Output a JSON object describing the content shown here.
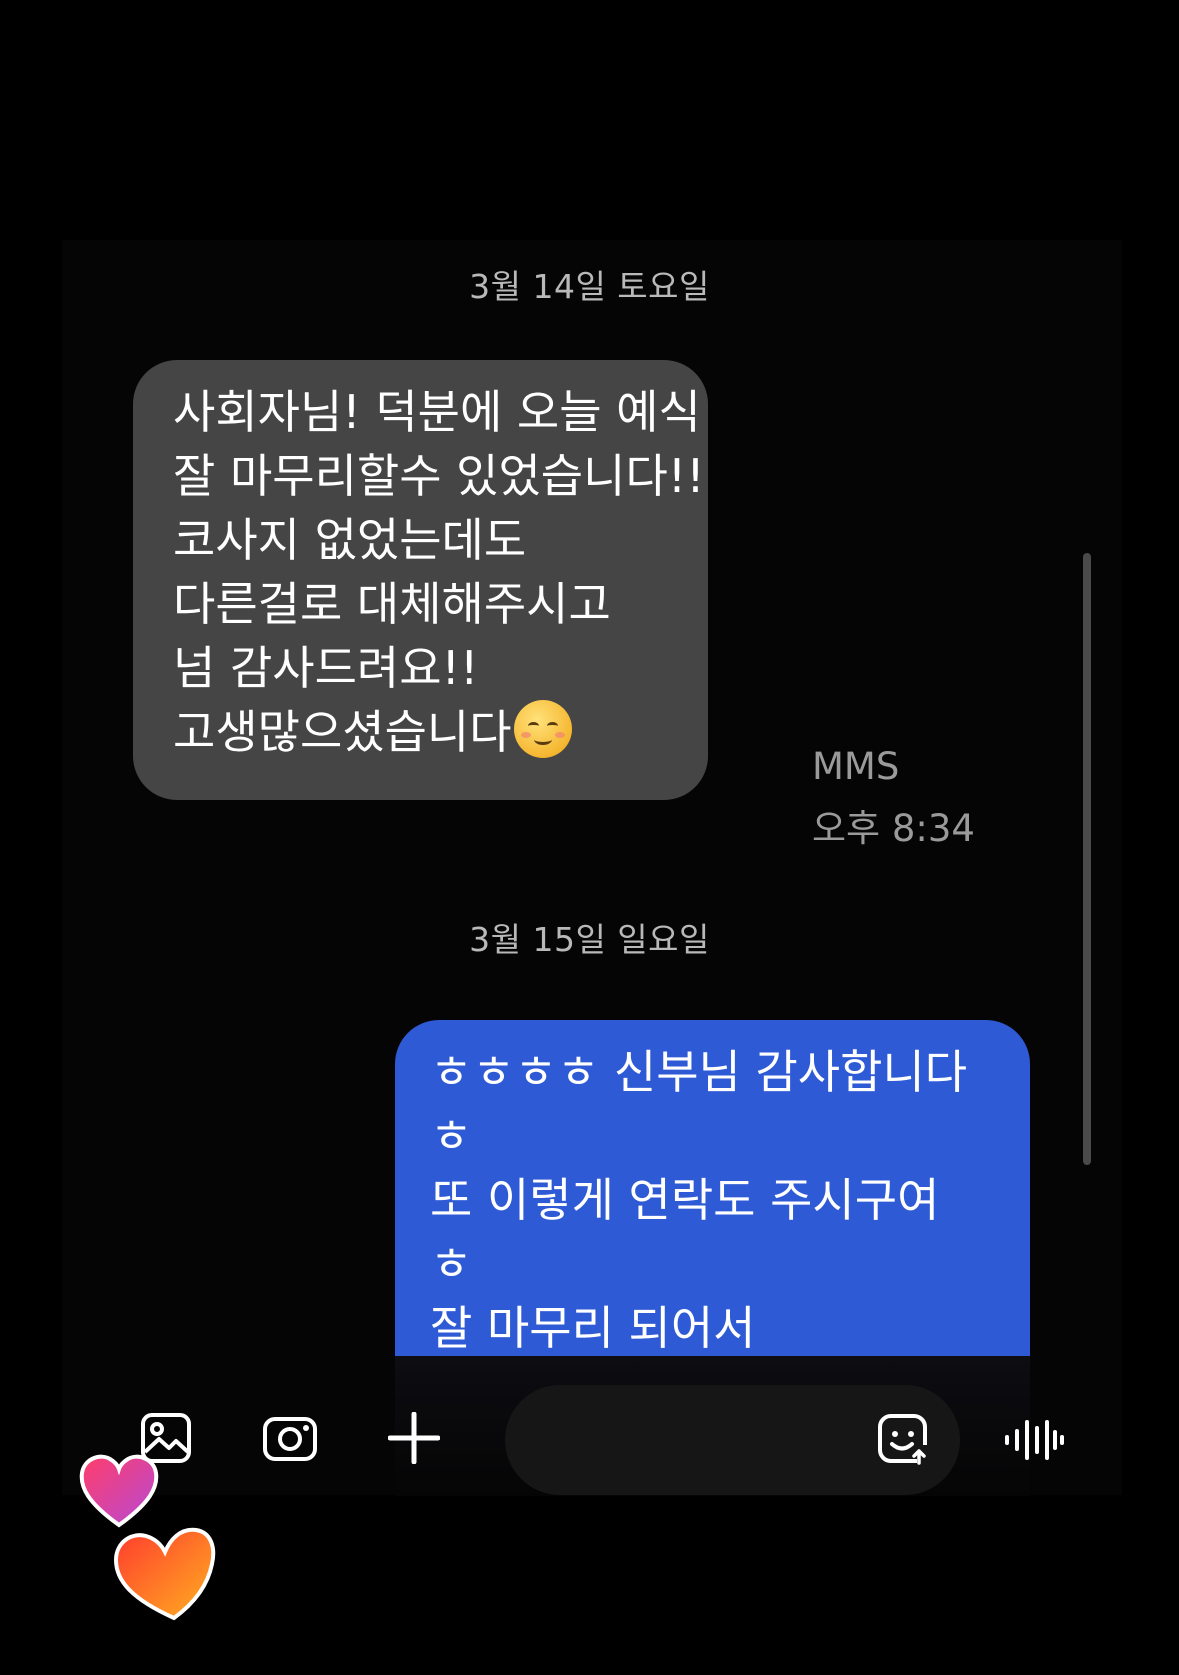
{
  "dates": {
    "first": "3월 14일 토요일",
    "second": "3월 15일 일요일"
  },
  "messages": [
    {
      "direction": "incoming",
      "text": "사회자님! 덕분에 오늘 예식\n잘 마무리할수 있었습니다!!\n코사지 없었는데도\n다른걸로 대체해주시고\n넘 감사드려요!!\n고생많으셨습니다",
      "emoji": "smiling-face-with-smiling-eyes",
      "type_label": "MMS",
      "time": "오후 8:34"
    },
    {
      "direction": "outgoing",
      "text": "ㅎㅎㅎㅎ 신부님 감사합니다\nㅎ\n또 이렇게 연락도 주시구여\nㅎ\n잘 마무리 되어서"
    }
  ],
  "composer": {
    "icons": [
      "gallery-icon",
      "camera-icon",
      "plus-icon",
      "sticker-icon",
      "voice-icon"
    ]
  },
  "colors": {
    "incoming_bubble": "#454545",
    "outgoing_bubble": "#2e5ad5",
    "background": "#000000"
  }
}
